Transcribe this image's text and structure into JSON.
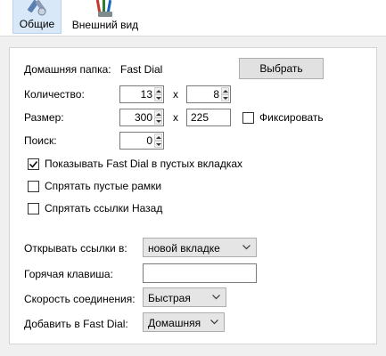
{
  "toolbar": {
    "general_label": "Общие",
    "appearance_label": "Внешний вид"
  },
  "form": {
    "home_folder_label": "Домашняя папка:",
    "home_folder_value": "Fast Dial",
    "choose_button": "Выбрать",
    "count_label": "Количество:",
    "count_cols": "13",
    "count_rows": "8",
    "size_label": "Размер:",
    "size_width": "300",
    "size_height": "225",
    "x_sep": "x",
    "fix_label": "Фиксировать",
    "search_label": "Поиск:",
    "search_value": "0",
    "show_in_empty_tabs": "Показывать Fast Dial в пустых вкладках",
    "hide_empty_frames": "Спрятать пустые рамки",
    "hide_back_links": "Спрятать ссылки Назад",
    "open_links_label": "Открывать ссылки в:",
    "open_links_value": "новой вкладке",
    "hotkey_label": "Горячая клавиша:",
    "hotkey_value": "",
    "speed_label": "Скорость соединения:",
    "speed_value": "Быстрая",
    "add_to_label": "Добавить в Fast Dial:",
    "add_to_value": "Домашняя"
  },
  "checkboxes": {
    "show_in_empty_tabs": true,
    "hide_empty_frames": false,
    "hide_back_links": false,
    "fix": false
  }
}
